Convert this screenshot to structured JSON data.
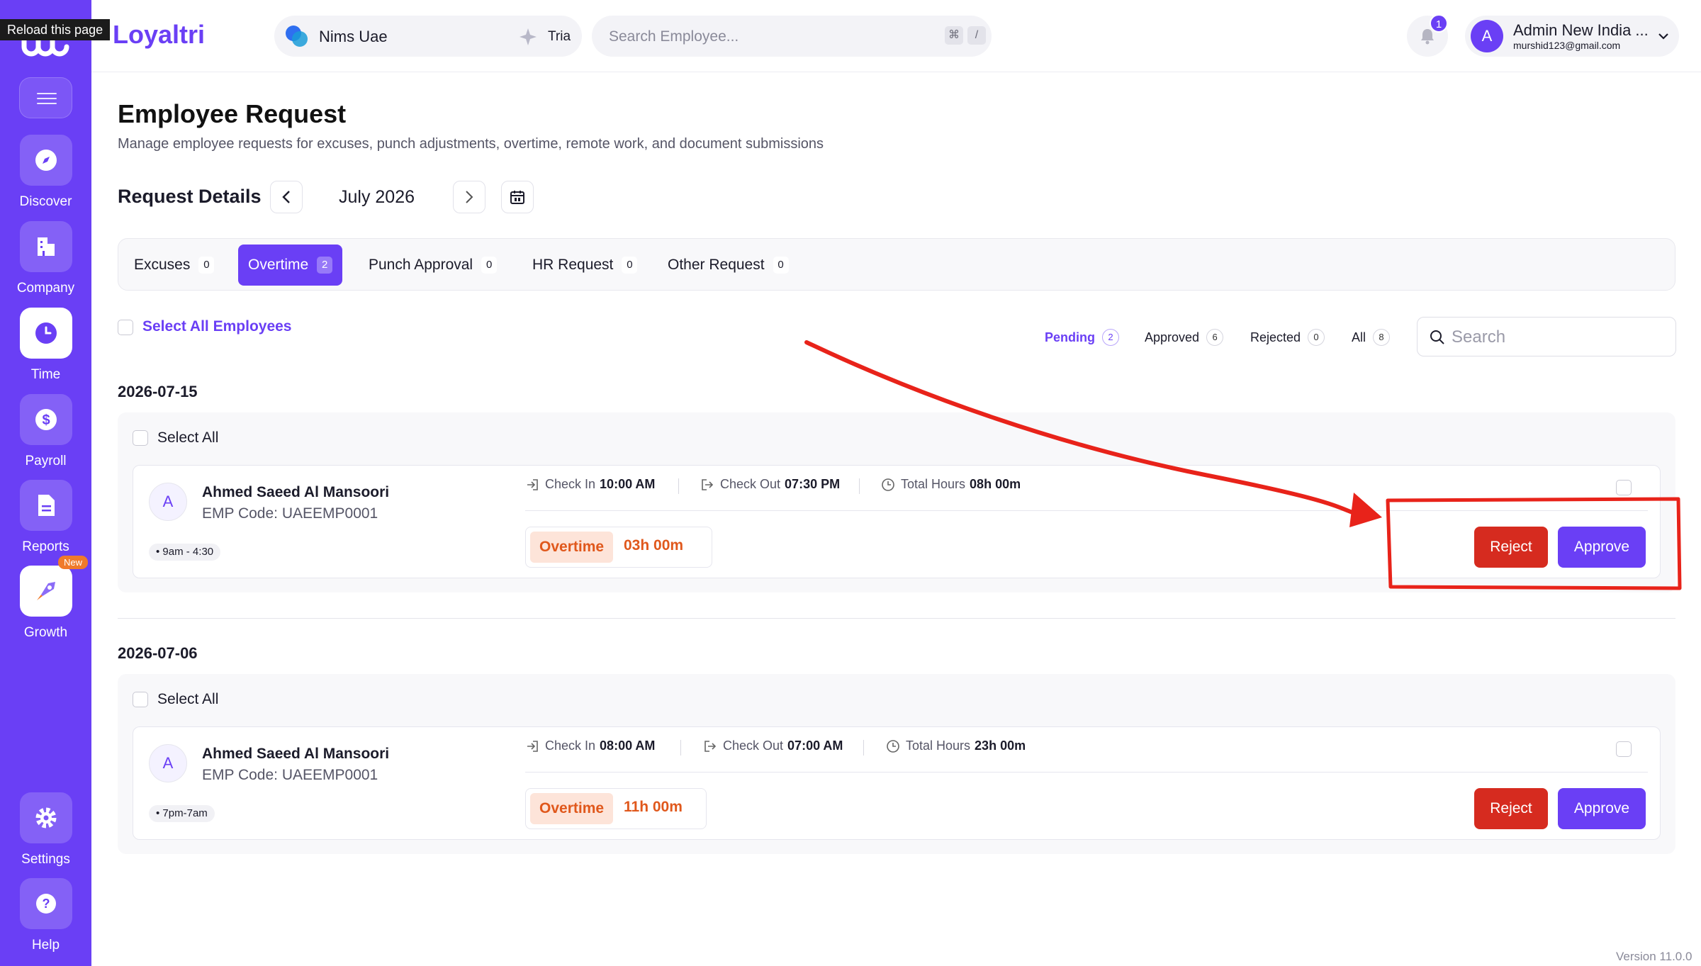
{
  "tooltip": "Reload this page",
  "brand": "Loyaltri",
  "sidebar": {
    "items": [
      {
        "label": "Discover",
        "icon": "compass-icon"
      },
      {
        "label": "Company",
        "icon": "building-icon"
      },
      {
        "label": "Time",
        "icon": "clock-icon"
      },
      {
        "label": "Payroll",
        "icon": "dollar-icon"
      },
      {
        "label": "Reports",
        "icon": "document-icon"
      },
      {
        "label": "Growth",
        "icon": "rocket-icon",
        "badge": "New"
      },
      {
        "label": "Settings",
        "icon": "gear-icon"
      },
      {
        "label": "Help",
        "icon": "help-icon"
      }
    ]
  },
  "header": {
    "company": "Nims Uae",
    "tria": "Tria",
    "search_placeholder": "Search Employee...",
    "shortcut_cmd": "⌘",
    "shortcut_key": "/",
    "notif_count": "1",
    "user_initial": "A",
    "user_name": "Admin New India ...",
    "user_email": "murshid123@gmail.com"
  },
  "page": {
    "title": "Employee Request",
    "subtitle": "Manage employee requests for excuses, punch adjustments, overtime, remote work, and document submissions",
    "section_title": "Request Details",
    "month": "July 2026"
  },
  "tabs": [
    {
      "label": "Excuses",
      "count": "0"
    },
    {
      "label": "Overtime",
      "count": "2"
    },
    {
      "label": "Punch Approval",
      "count": "0"
    },
    {
      "label": "HR Request",
      "count": "0"
    },
    {
      "label": "Other Request",
      "count": "0"
    }
  ],
  "select_all_employees": "Select All Employees",
  "status_filters": [
    {
      "label": "Pending",
      "count": "2"
    },
    {
      "label": "Approved",
      "count": "6"
    },
    {
      "label": "Rejected",
      "count": "0"
    },
    {
      "label": "All",
      "count": "8"
    }
  ],
  "search_placeholder": "Search",
  "groups": [
    {
      "date": "2026-07-15",
      "select_all": "Select All",
      "request": {
        "initial": "A",
        "name": "Ahmed Saeed Al Mansoori",
        "emp_code": "EMP Code: UAEEMP0001",
        "shift": "9am - 4:30",
        "check_in_label": "Check In",
        "check_in": "10:00 AM",
        "check_out_label": "Check Out",
        "check_out": "07:30 PM",
        "total_label": "Total Hours",
        "total": "08h 00m",
        "ot_label": "Overtime",
        "ot_value": "03h 00m",
        "reject": "Reject",
        "approve": "Approve"
      }
    },
    {
      "date": "2026-07-06",
      "select_all": "Select All",
      "request": {
        "initial": "A",
        "name": "Ahmed Saeed Al Mansoori",
        "emp_code": "EMP Code: UAEEMP0001",
        "shift": "7pm-7am",
        "check_in_label": "Check In",
        "check_in": "08:00 AM",
        "check_out_label": "Check Out",
        "check_out": "07:00 AM",
        "total_label": "Total Hours",
        "total": "23h 00m",
        "ot_label": "Overtime",
        "ot_value": "11h 00m",
        "reject": "Reject",
        "approve": "Approve"
      }
    }
  ],
  "version": "Version 11.0.0",
  "colors": {
    "accent": "#6a3ff5",
    "reject": "#d62b1f",
    "overtime": "#e0581c",
    "annotation": "#e8231a"
  }
}
